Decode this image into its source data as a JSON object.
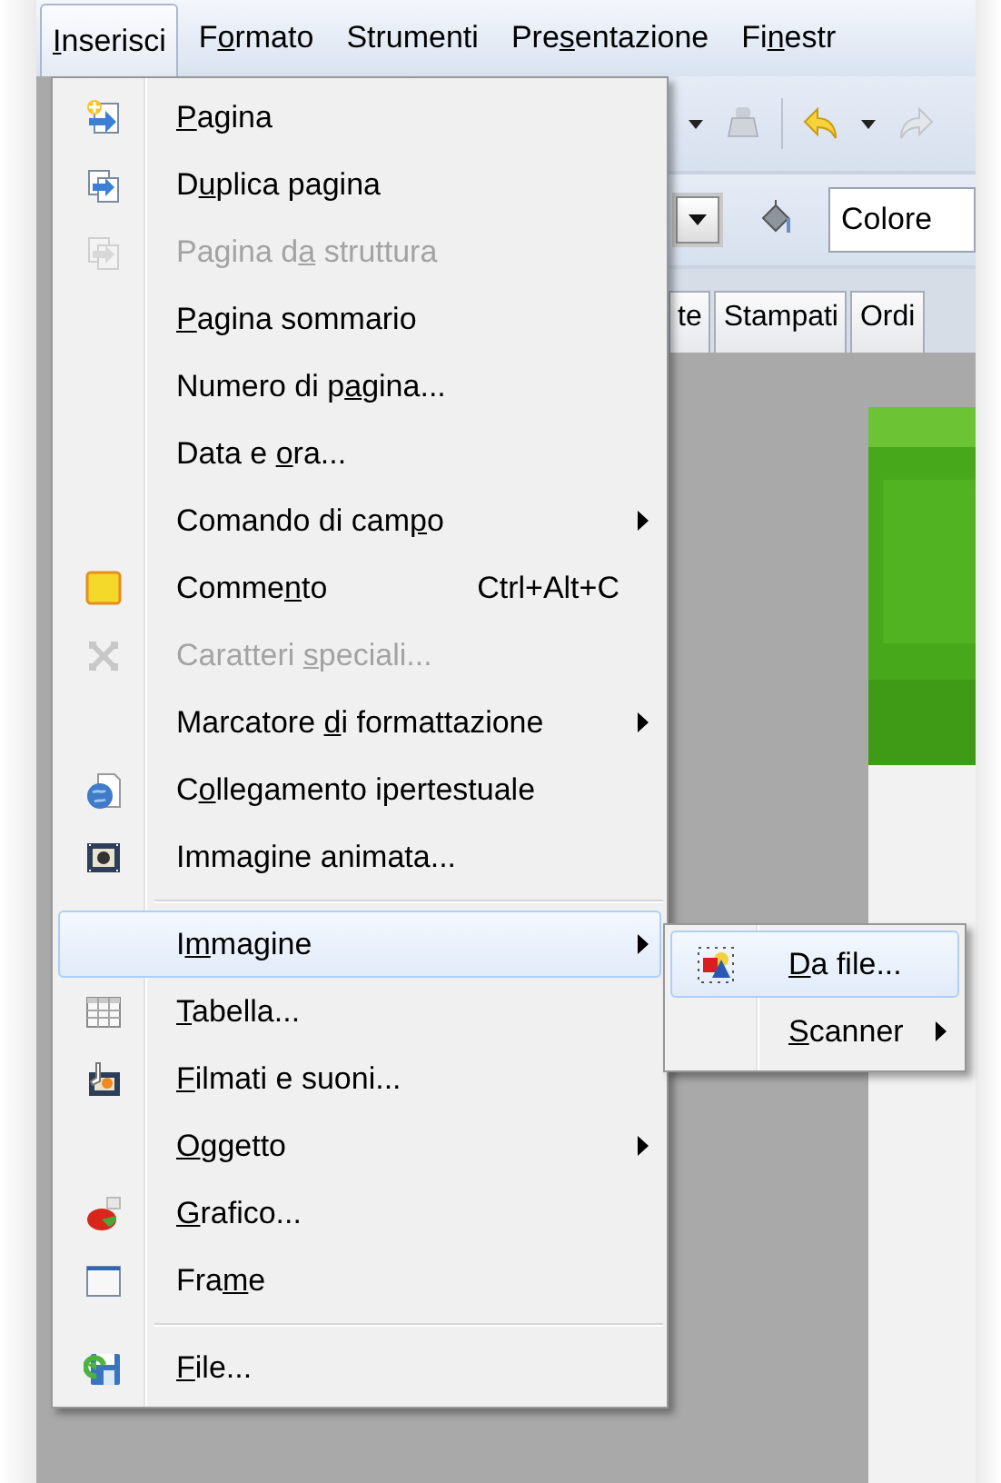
{
  "menubar": [
    {
      "label_parts": [
        {
          "text": "I",
          "underline": true
        },
        {
          "text": "nserisci",
          "underline": false
        }
      ],
      "selected": true
    },
    {
      "label_parts": [
        {
          "text": "F",
          "underline": false
        },
        {
          "text": "o",
          "underline": true
        },
        {
          "text": "rmato",
          "underline": false
        }
      ],
      "selected": false
    },
    {
      "label_parts": [
        {
          "text": "Strumenti",
          "underline": false
        }
      ],
      "selected": false
    },
    {
      "label_parts": [
        {
          "text": "Pre",
          "underline": false
        },
        {
          "text": "s",
          "underline": true
        },
        {
          "text": "entazione",
          "underline": false
        }
      ],
      "selected": false
    },
    {
      "label_parts": [
        {
          "text": "Fi",
          "underline": false
        },
        {
          "text": "n",
          "underline": true
        },
        {
          "text": "estr",
          "underline": false
        }
      ],
      "selected": false
    }
  ],
  "toolbar": {
    "color_field": {
      "value": "Colore"
    }
  },
  "tabs": [
    {
      "label": "te"
    },
    {
      "label": "Stampati"
    },
    {
      "label": "Ordi"
    }
  ],
  "menu": {
    "items": [
      {
        "kind": "item",
        "label_parts": [
          {
            "text": "P",
            "underline": true
          },
          {
            "text": "agina",
            "underline": false
          }
        ],
        "disabled": false,
        "selected": false,
        "submenu": false
      },
      {
        "kind": "item",
        "label_parts": [
          {
            "text": "D",
            "underline": false
          },
          {
            "text": "u",
            "underline": true
          },
          {
            "text": "plica pagina",
            "underline": false
          }
        ],
        "disabled": false,
        "selected": false,
        "submenu": false
      },
      {
        "kind": "item",
        "label_parts": [
          {
            "text": "Pagina d",
            "underline": false
          },
          {
            "text": "a",
            "underline": true
          },
          {
            "text": " struttura",
            "underline": false
          }
        ],
        "disabled": true,
        "selected": false,
        "submenu": false
      },
      {
        "kind": "item",
        "label_parts": [
          {
            "text": "P",
            "underline": true
          },
          {
            "text": "agina sommario",
            "underline": false
          }
        ],
        "disabled": false,
        "selected": false,
        "submenu": false
      },
      {
        "kind": "item",
        "label_parts": [
          {
            "text": "Numero di p",
            "underline": false
          },
          {
            "text": "a",
            "underline": true
          },
          {
            "text": "gina...",
            "underline": false
          }
        ],
        "disabled": false,
        "selected": false,
        "submenu": false
      },
      {
        "kind": "item",
        "label_parts": [
          {
            "text": "Data e ",
            "underline": false
          },
          {
            "text": "o",
            "underline": true
          },
          {
            "text": "ra...",
            "underline": false
          }
        ],
        "disabled": false,
        "selected": false,
        "submenu": false
      },
      {
        "kind": "item",
        "label_parts": [
          {
            "text": "Comando di cam",
            "underline": false
          },
          {
            "text": "p",
            "underline": true
          },
          {
            "text": "o",
            "underline": false
          }
        ],
        "disabled": false,
        "selected": false,
        "submenu": true
      },
      {
        "kind": "item",
        "label_parts": [
          {
            "text": "Comme",
            "underline": false
          },
          {
            "text": "n",
            "underline": true
          },
          {
            "text": "to",
            "underline": false
          }
        ],
        "shortcut": "Ctrl+Alt+C",
        "disabled": false,
        "selected": false,
        "submenu": false
      },
      {
        "kind": "item",
        "label_parts": [
          {
            "text": "Caratteri ",
            "underline": false
          },
          {
            "text": "s",
            "underline": true
          },
          {
            "text": "peciali...",
            "underline": false
          }
        ],
        "disabled": true,
        "selected": false,
        "submenu": false
      },
      {
        "kind": "item",
        "label_parts": [
          {
            "text": "Marcatore ",
            "underline": false
          },
          {
            "text": "d",
            "underline": true
          },
          {
            "text": "i formattazione",
            "underline": false
          }
        ],
        "disabled": false,
        "selected": false,
        "submenu": true
      },
      {
        "kind": "item",
        "label_parts": [
          {
            "text": "C",
            "underline": false
          },
          {
            "text": "o",
            "underline": true
          },
          {
            "text": "llegamento ipertestuale",
            "underline": false
          }
        ],
        "disabled": false,
        "selected": false,
        "submenu": false
      },
      {
        "kind": "item",
        "label_parts": [
          {
            "text": "Immagine animata...",
            "underline": false
          }
        ],
        "disabled": false,
        "selected": false,
        "submenu": false
      },
      {
        "kind": "separator"
      },
      {
        "kind": "item",
        "label_parts": [
          {
            "text": "I",
            "underline": false
          },
          {
            "text": "m",
            "underline": true
          },
          {
            "text": "magine",
            "underline": false
          }
        ],
        "disabled": false,
        "selected": true,
        "submenu": true
      },
      {
        "kind": "item",
        "label_parts": [
          {
            "text": "T",
            "underline": true
          },
          {
            "text": "abella...",
            "underline": false
          }
        ],
        "disabled": false,
        "selected": false,
        "submenu": false
      },
      {
        "kind": "item",
        "label_parts": [
          {
            "text": "F",
            "underline": true
          },
          {
            "text": "ilmati e suoni...",
            "underline": false
          }
        ],
        "disabled": false,
        "selected": false,
        "submenu": false
      },
      {
        "kind": "item",
        "label_parts": [
          {
            "text": "O",
            "underline": true
          },
          {
            "text": "ggetto",
            "underline": false
          }
        ],
        "disabled": false,
        "selected": false,
        "submenu": true
      },
      {
        "kind": "item",
        "label_parts": [
          {
            "text": "G",
            "underline": true
          },
          {
            "text": "rafico...",
            "underline": false
          }
        ],
        "disabled": false,
        "selected": false,
        "submenu": false
      },
      {
        "kind": "item",
        "label_parts": [
          {
            "text": "Fra",
            "underline": false
          },
          {
            "text": "m",
            "underline": true
          },
          {
            "text": "e",
            "underline": false
          }
        ],
        "disabled": false,
        "selected": false,
        "submenu": false
      },
      {
        "kind": "separator"
      },
      {
        "kind": "item",
        "label_parts": [
          {
            "text": "F",
            "underline": true
          },
          {
            "text": "ile...",
            "underline": false
          }
        ],
        "disabled": false,
        "selected": false,
        "submenu": false
      }
    ]
  },
  "submenu": {
    "items": [
      {
        "kind": "item",
        "label_parts": [
          {
            "text": "D",
            "underline": true
          },
          {
            "text": "a file...",
            "underline": false
          }
        ],
        "disabled": false,
        "selected": true,
        "submenu": false
      },
      {
        "kind": "item",
        "label_parts": [
          {
            "text": "S",
            "underline": true
          },
          {
            "text": "canner",
            "underline": false
          }
        ],
        "disabled": false,
        "selected": false,
        "submenu": true
      }
    ]
  }
}
